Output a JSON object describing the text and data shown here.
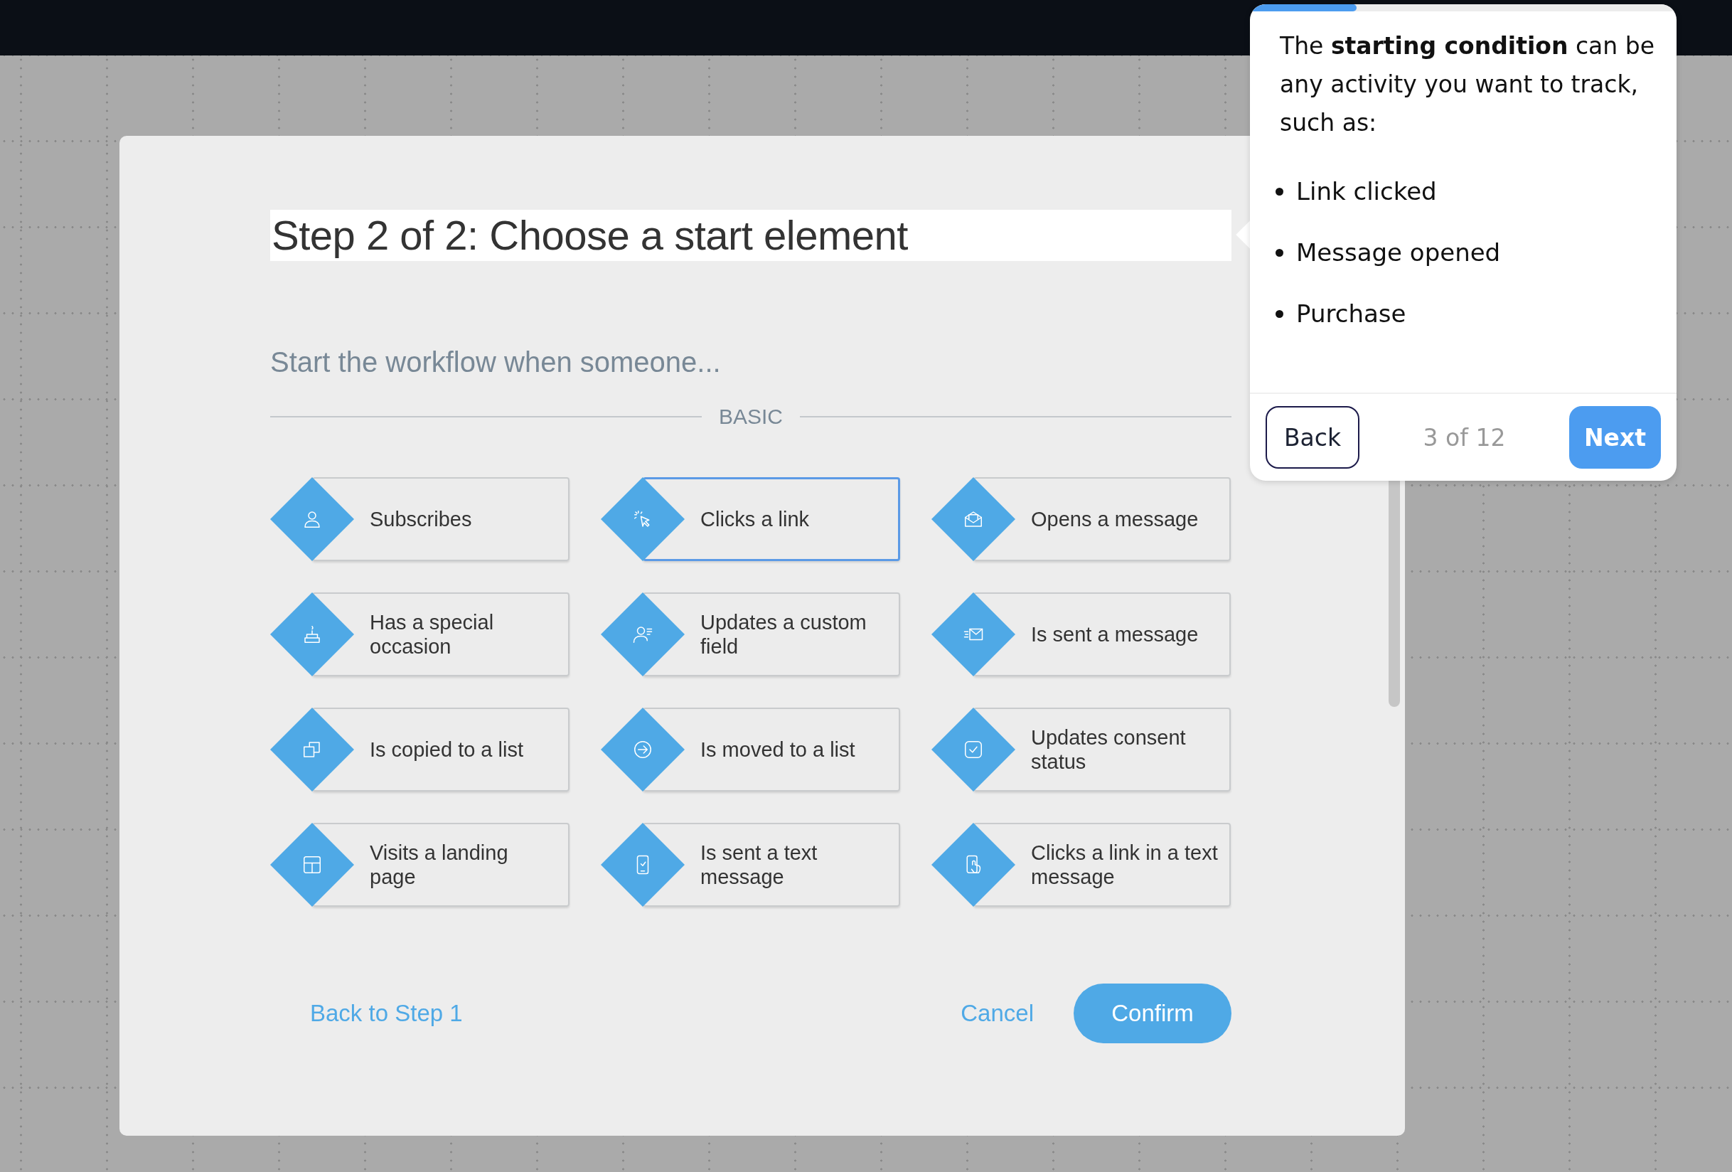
{
  "dialog": {
    "title": "Step 2 of 2: Choose a start element",
    "subtitle": "Start the workflow when someone...",
    "section": "BASIC",
    "elements": [
      {
        "label": "Subscribes",
        "selected": false
      },
      {
        "label": "Clicks a link",
        "selected": true
      },
      {
        "label": "Opens a message",
        "selected": false
      },
      {
        "label": "Has a special occasion",
        "selected": false
      },
      {
        "label": "Updates a custom field",
        "selected": false
      },
      {
        "label": "Is sent a message",
        "selected": false
      },
      {
        "label": "Is copied to a list",
        "selected": false
      },
      {
        "label": "Is moved to a list",
        "selected": false
      },
      {
        "label": "Updates consent status",
        "selected": false
      },
      {
        "label": "Visits a landing page",
        "selected": false
      },
      {
        "label": "Is sent a text message",
        "selected": false
      },
      {
        "label": "Clicks a link in a text message",
        "selected": false
      }
    ],
    "back_link": "Back to Step 1",
    "cancel": "Cancel",
    "confirm": "Confirm"
  },
  "tour": {
    "progress": {
      "level": 0.25
    },
    "text": "The **starting condition** can be any activity you want to track, such as:",
    "bullets": [
      "Link clicked",
      "Message opened",
      "Purchase"
    ],
    "back": "Back",
    "counter": "3 of 12",
    "next": "Next"
  }
}
